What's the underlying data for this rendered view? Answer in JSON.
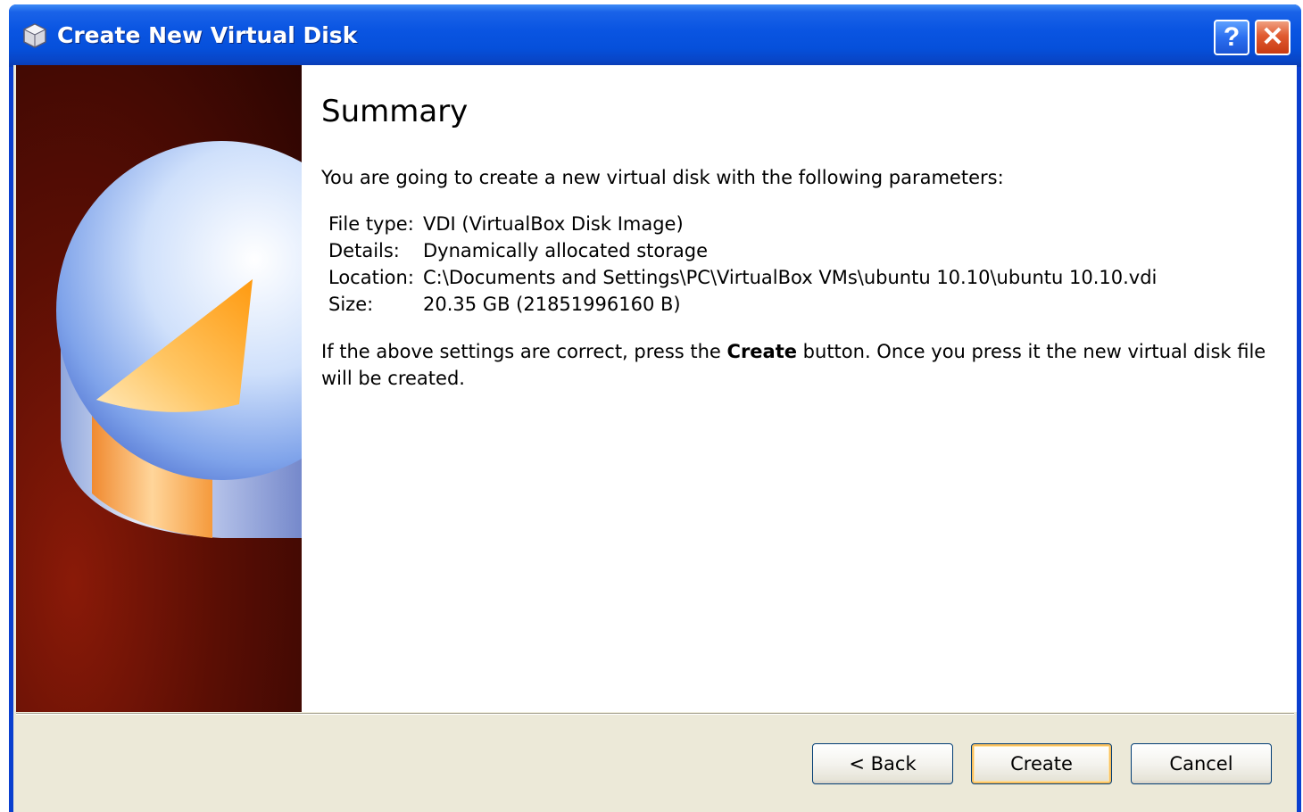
{
  "window": {
    "title": "Create New Virtual Disk",
    "title_icon": "virtualbox-icon",
    "help_label": "?",
    "close_label": "✕"
  },
  "page": {
    "heading": "Summary",
    "intro": "You are going to create a new virtual disk with the following parameters:",
    "params": [
      {
        "label": "File type:",
        "value": "VDI (VirtualBox Disk Image)"
      },
      {
        "label": "Details:",
        "value": "Dynamically allocated storage"
      },
      {
        "label": "Location:",
        "value": "C:\\Documents and Settings\\PC\\VirtualBox VMs\\ubuntu 10.10\\ubuntu 10.10.vdi"
      },
      {
        "label": "Size:",
        "value": "20.35 GB (21851996160 B)"
      }
    ],
    "note_before": "If the above settings are correct, press the ",
    "note_bold": "Create",
    "note_after": " button. Once you press it the new virtual disk file will be created."
  },
  "buttons": {
    "back": "< Back",
    "create": "Create",
    "cancel": "Cancel"
  },
  "colors": {
    "titlebar": "#0a55e2",
    "dialog_bg": "#ece9d8",
    "side_panel": "#5a0e04",
    "default_button_highlight": "#f9c060"
  }
}
